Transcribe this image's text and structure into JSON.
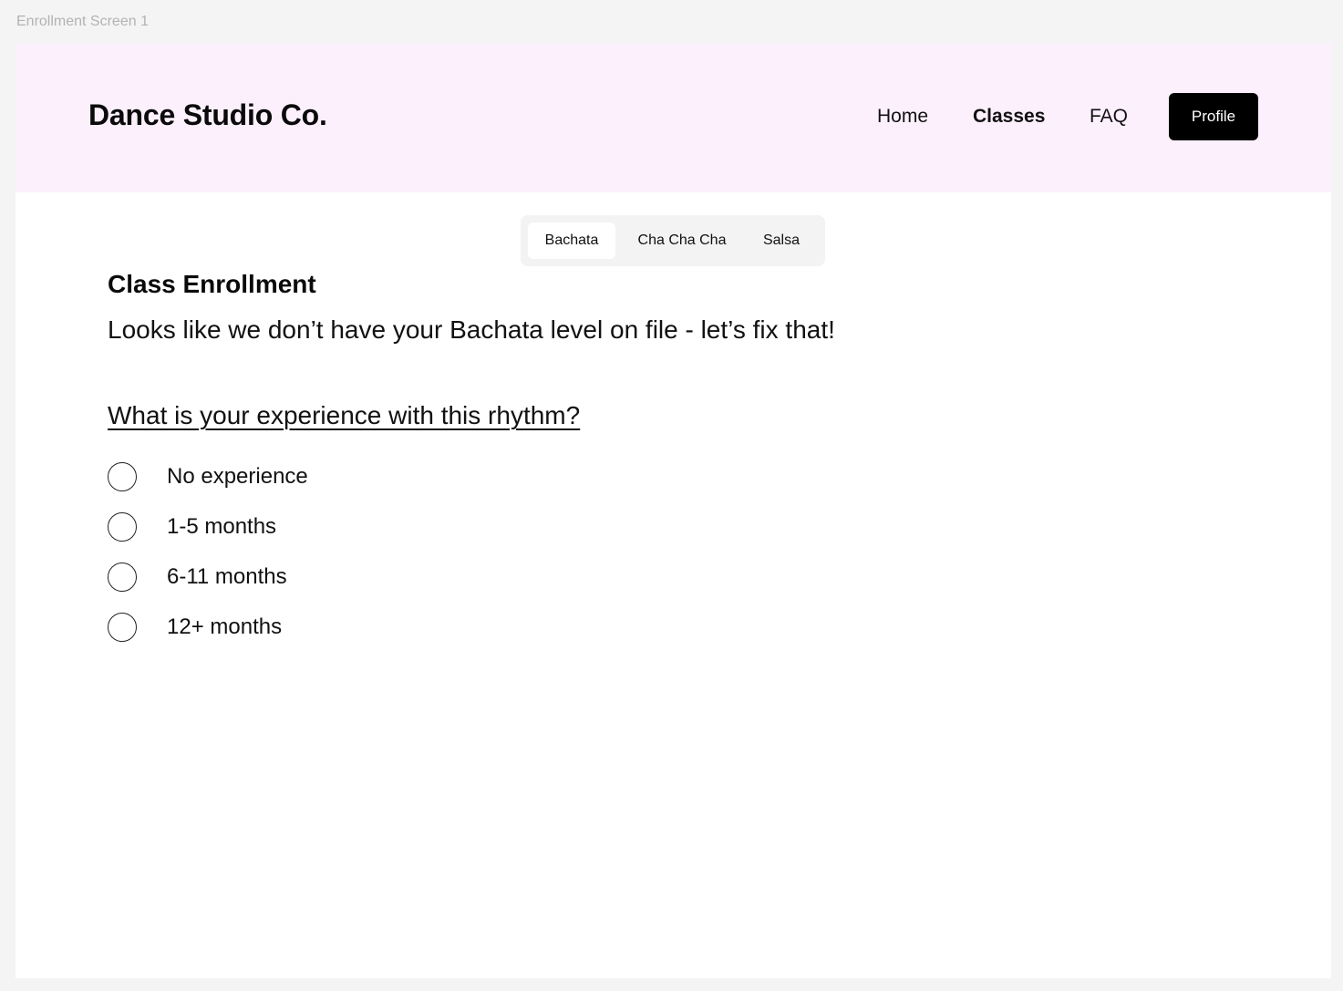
{
  "frame": {
    "label": "Enrollment Screen 1"
  },
  "header": {
    "brand": "Dance Studio Co.",
    "background": "#fdf0fd",
    "nav": {
      "home": "Home",
      "classes": "Classes",
      "faq": "FAQ",
      "active": "Classes"
    },
    "profile_label": "Profile"
  },
  "tabs": {
    "items": [
      "Bachata",
      "Cha Cha Cha",
      "Salsa"
    ],
    "selected": "Bachata"
  },
  "main": {
    "title": "Class Enrollment",
    "intro": "Looks like we don’t have your Bachata level on file - let’s fix that!",
    "question": "What is your experience with this rhythm?",
    "options": [
      "No experience",
      "1-5 months",
      "6-11 months",
      "12+ months"
    ]
  }
}
